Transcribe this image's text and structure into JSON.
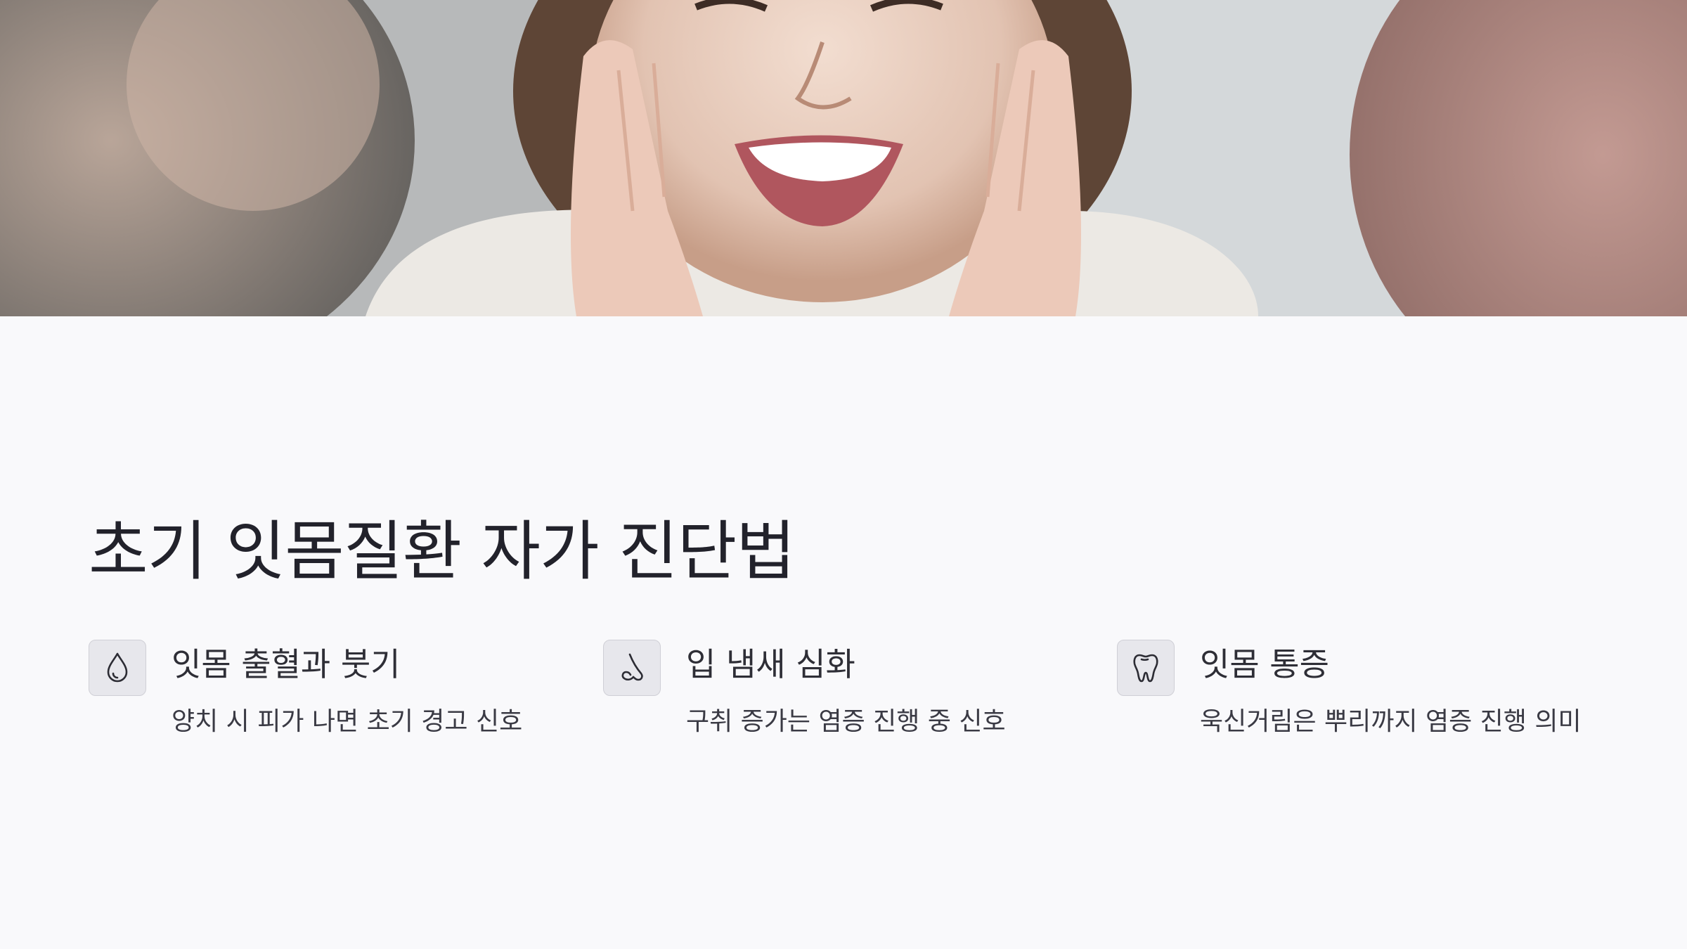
{
  "hero": {
    "photo": "smiling-woman-photo"
  },
  "title": "초기 잇몸질환 자가 진단법",
  "features": [
    {
      "icon": "droplet-icon",
      "title": "잇몸 출혈과 붓기",
      "desc": "양치 시 피가 나면 초기 경고 신호"
    },
    {
      "icon": "nose-icon",
      "title": "입 냄새 심화",
      "desc": "구취 증가는 염증 진행 중 신호"
    },
    {
      "icon": "tooth-icon",
      "title": "잇몸 통증",
      "desc": "욱신거림은 뿌리까지 염증 진행 의미"
    }
  ],
  "colors": {
    "background": "#f9f9fb",
    "icon_box": "#e7e7ec",
    "text": "#22222b"
  }
}
